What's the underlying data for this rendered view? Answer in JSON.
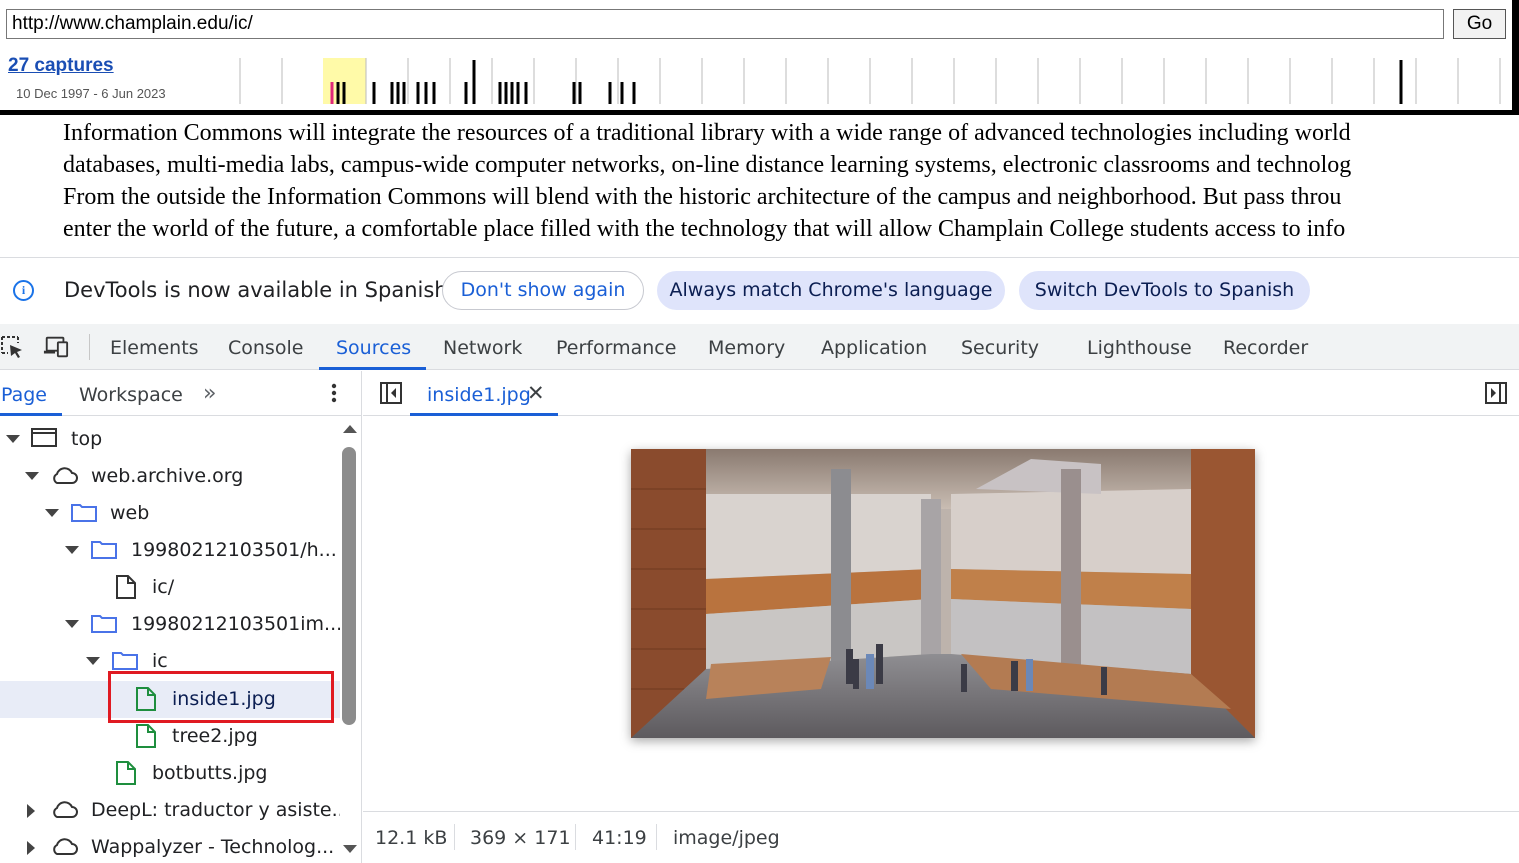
{
  "wayback": {
    "url": "http://www.champlain.edu/ic/",
    "go_label": "Go",
    "captures_label": "27 captures",
    "date_range": "10 Dec 1997 - 6 Jun 2023"
  },
  "page_text": {
    "lines": [
      "Information Commons will integrate the resources of a traditional library with a wide range of advanced technologies including world",
      "databases, multi-media labs, campus-wide computer networks, on-line distance learning systems, electronic classrooms and technolog",
      "From the outside the Information Commons will blend with the historic architecture of the campus and neighborhood. But pass throu",
      "enter the world of the future, a comfortable place filled with the technology that will allow Champlain College students access to info"
    ]
  },
  "infobar": {
    "message": "DevTools is now available in Spanish",
    "dont_show": "Don't show again",
    "always_match": "Always match Chrome's language",
    "switch": "Switch DevTools to Spanish"
  },
  "devtools_tabs": [
    "Elements",
    "Console",
    "Sources",
    "Network",
    "Performance",
    "Memory",
    "Application",
    "Security",
    "Lighthouse",
    "Recorder"
  ],
  "active_tab": "Sources",
  "navigator": {
    "tabs": [
      "Page",
      "Workspace"
    ],
    "more": "»",
    "tree": [
      {
        "label": "top",
        "icon": "frame-icon",
        "expanded": true
      },
      {
        "label": "web.archive.org",
        "icon": "cloud-icon",
        "expanded": true
      },
      {
        "label": "web",
        "icon": "folder-icon",
        "expanded": true
      },
      {
        "label": "19980212103501/h...",
        "icon": "folder-icon",
        "expanded": true
      },
      {
        "label": "ic/",
        "icon": "document-icon"
      },
      {
        "label": "19980212103501im...",
        "icon": "folder-icon",
        "expanded": true
      },
      {
        "label": "ic",
        "icon": "folder-icon",
        "expanded": true
      },
      {
        "label": "inside1.jpg",
        "icon": "image-file-icon",
        "selected": true
      },
      {
        "label": "tree2.jpg",
        "icon": "image-file-icon"
      },
      {
        "label": "botbutts.jpg",
        "icon": "image-file-icon"
      },
      {
        "label": "DeepL: traductor y asiste...",
        "icon": "cloud-icon",
        "expanded": false
      },
      {
        "label": "Wappalyzer - Technolog...",
        "icon": "cloud-icon",
        "expanded": false
      }
    ]
  },
  "editor": {
    "open_file": "inside1.jpg",
    "close_glyph": "✕",
    "status": {
      "size": "12.1 kB",
      "dimensions": "369 × 171",
      "ratio": "41:19",
      "mime": "image/jpeg"
    }
  },
  "colors": {
    "accent": "#1a5fd6",
    "highlight_box": "#e01a22",
    "file_icon_green": "#1e8e3e",
    "folder_icon_blue": "#4a73e8"
  }
}
